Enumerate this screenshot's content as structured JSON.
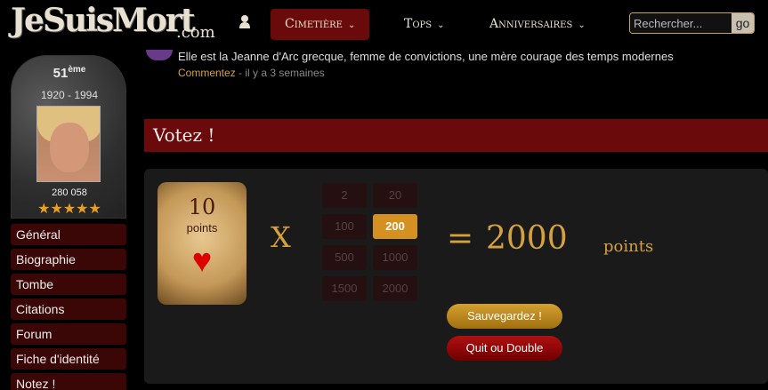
{
  "site": {
    "logo": "JeSuisMort",
    "logo_suffix": ".com"
  },
  "nav": {
    "items": [
      {
        "label": "Cimetière",
        "chevron": "⌄",
        "active": true
      },
      {
        "label": "Tops",
        "chevron": "⌄",
        "active": false
      },
      {
        "label": "Anniversaires",
        "chevron": "⌄",
        "active": false
      }
    ],
    "search_placeholder": "Rechercher...",
    "search_button": "go"
  },
  "profile": {
    "rank": "51",
    "rank_suffix": "ème",
    "years": "1920 - 1994",
    "score": "280 058",
    "stars": "★★★★★",
    "rating_stars": 5
  },
  "sidebar": {
    "items": [
      {
        "label": "Général"
      },
      {
        "label": "Biographie"
      },
      {
        "label": "Tombe"
      },
      {
        "label": "Citations"
      },
      {
        "label": "Forum"
      },
      {
        "label": "Fiche d'identité"
      },
      {
        "label": "Notez !"
      }
    ]
  },
  "feed": {
    "text": "Elle est la Jeanne d'Arc grecque, femme de convictions, une mère courage des temps modernes",
    "comment_link": "Commentez",
    "time": " - il y a 3 semaines"
  },
  "vote": {
    "title": "Votez !",
    "card_points": "10",
    "card_label": "points",
    "card_suit": "♥",
    "times": "X",
    "multipliers": [
      "2",
      "20",
      "100",
      "200",
      "500",
      "1000",
      "1500",
      "2000"
    ],
    "selected_multiplier": "200",
    "equals": "=",
    "result": "2000",
    "result_unit": "points",
    "save_button": "Sauvegardez !",
    "double_button": "Quit ou Double"
  },
  "colors": {
    "accent_red": "#6b0a0a",
    "gold": "#d4a040",
    "selected": "#d49020"
  }
}
